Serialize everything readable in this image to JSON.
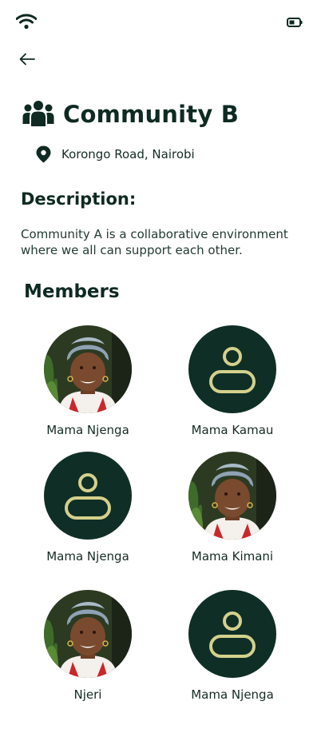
{
  "header": {
    "title": "Community B",
    "location": "Korongo Road, Nairobi"
  },
  "description": {
    "heading": "Description:",
    "text": "Community A is a collaborative environment where we all can support each other."
  },
  "members": {
    "heading": "Members",
    "items": [
      {
        "name": "Mama Njenga",
        "avatar": "photo"
      },
      {
        "name": "Mama Kamau",
        "avatar": "placeholder"
      },
      {
        "name": "Mama Njenga",
        "avatar": "placeholder"
      },
      {
        "name": "Mama Kimani",
        "avatar": "photo"
      },
      {
        "name": "Njeri",
        "avatar": "photo"
      },
      {
        "name": "Mama Njenga",
        "avatar": "placeholder"
      }
    ]
  },
  "colors": {
    "primary_dark": "#0f2e26",
    "placeholder_icon": "#d4d08c"
  }
}
